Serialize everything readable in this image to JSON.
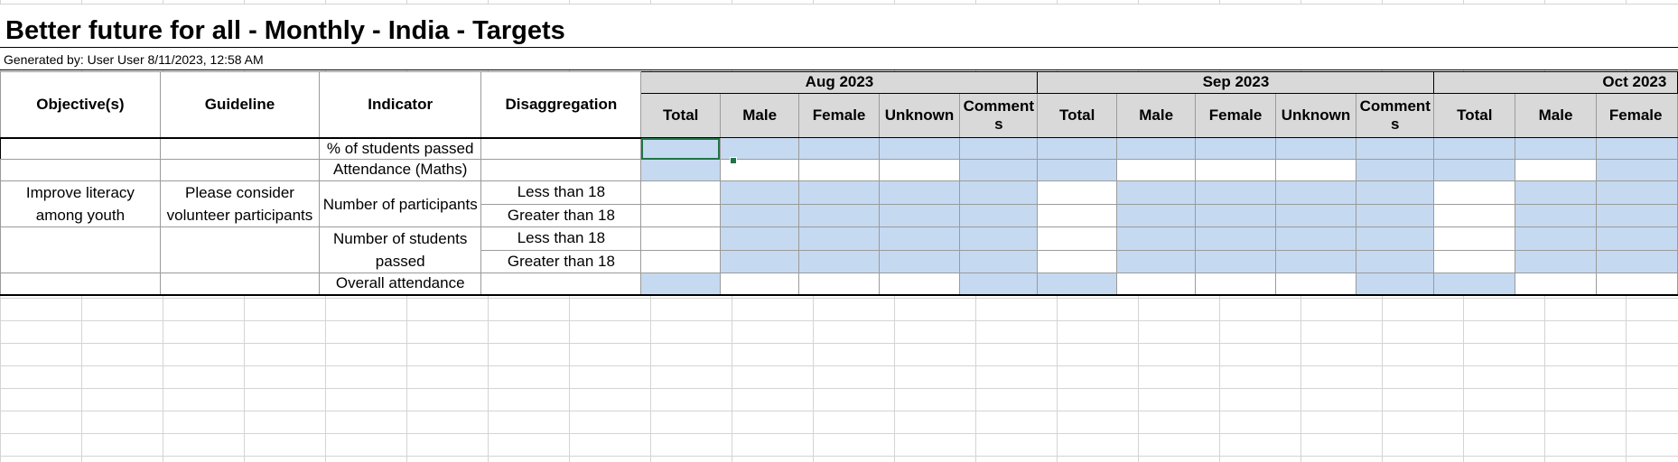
{
  "report": {
    "title": "Better future for all - Monthly - India - Targets",
    "generated": "Generated by: User User 8/11/2023, 12:58 AM"
  },
  "headers": {
    "objectives": "Objective(s)",
    "guideline": "Guideline",
    "indicator": "Indicator",
    "disaggregation": "Disaggregation"
  },
  "months": [
    {
      "label": "Aug 2023",
      "cols": [
        "Total",
        "Male",
        "Female",
        "Unknown",
        "Comments"
      ]
    },
    {
      "label": "Sep 2023",
      "cols": [
        "Total",
        "Male",
        "Female",
        "Unknown",
        "Comments"
      ]
    },
    {
      "label": "Oct 2023",
      "cols": [
        "Total",
        "Male",
        "Female"
      ]
    }
  ],
  "rows": {
    "objective": "Improve literacy among youth",
    "guideline": "Please consider volunteer participants",
    "ind_passed_pct": "% of students passed",
    "ind_attendance_maths": "Attendance (Maths)",
    "ind_participants": "Number of participants",
    "ind_students_passed": "Number of students passed",
    "ind_overall_attendance": "Overall attendance",
    "dis_lt18_a": "Less than 18",
    "dis_gt18_a": "Greater than 18",
    "dis_lt18_b": "Less than 18",
    "dis_gt18_b": "Greater than 18"
  },
  "colors": {
    "header_bg": "#d9d9d9",
    "input_blue": "#c5d9f1",
    "selection_green": "#217346"
  }
}
